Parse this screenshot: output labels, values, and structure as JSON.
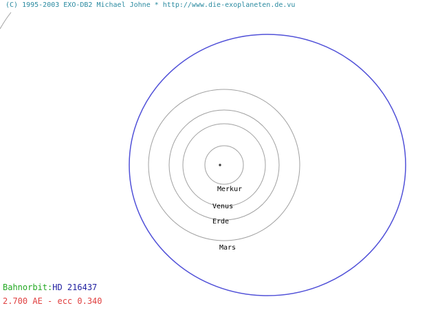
{
  "header": {
    "copyright": "(C) 1995-2003 EXO-DB2 Michael Johne * http://www.die-exoplaneten.de.vu"
  },
  "orbits": [
    {
      "name": "Merkur",
      "color": "#a0a0a0"
    },
    {
      "name": "Venus",
      "color": "#a0a0a0"
    },
    {
      "name": "Erde",
      "color": "#a0a0a0"
    },
    {
      "name": "Mars",
      "color": "#a0a0a0"
    }
  ],
  "exoplanet_orbit": {
    "color": "#5050d8"
  },
  "info": {
    "orbit_prefix": "Bahnorbit:",
    "star_name": "HD 216437",
    "params": "2.700 AE - ecc 0.340"
  },
  "colors": {
    "copyright": "#2a8aa0",
    "label_green": "#22a822",
    "label_blue": "#2020a0",
    "label_red": "#e04040"
  }
}
